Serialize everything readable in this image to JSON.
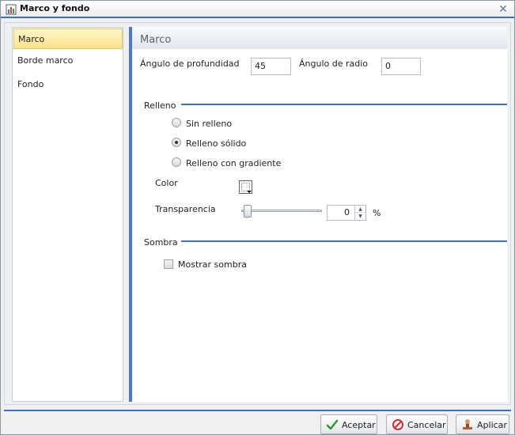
{
  "window": {
    "title": "Marco y fondo"
  },
  "nav": {
    "items": [
      {
        "label": "Marco",
        "active": true
      },
      {
        "label": "Borde marco",
        "active": false
      },
      {
        "label": "Fondo",
        "active": false
      }
    ]
  },
  "panel": {
    "title": "Marco",
    "depth_angle_label": "Ángulo de profundidad",
    "depth_angle_value": "45",
    "radius_angle_label": "Ángulo de radio",
    "radius_angle_value": "0",
    "fill_section": "Relleno",
    "fill_options": [
      {
        "label": "Sin relleno",
        "selected": false
      },
      {
        "label": "Relleno sólido",
        "selected": true
      },
      {
        "label": "Relleno con gradiente",
        "selected": false
      }
    ],
    "color_label": "Color",
    "transparency_label": "Transparencia",
    "transparency_value": "0",
    "transparency_unit": "%",
    "shadow_section": "Sombra",
    "show_shadow_label": "Mostrar sombra",
    "show_shadow_checked": false
  },
  "footer": {
    "accept_label": "Aceptar",
    "cancel_label": "Cancelar",
    "apply_label": "Aplicar"
  },
  "colors": {
    "accent": "#3d6fc4",
    "active_nav": "#ffe28a"
  }
}
